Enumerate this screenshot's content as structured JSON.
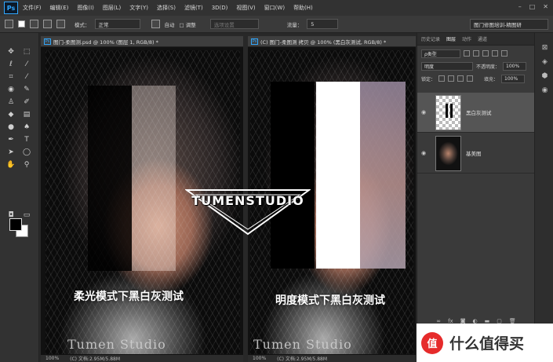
{
  "app": {
    "logo": "Ps",
    "window_buttons": [
      "–",
      "□",
      "✕"
    ]
  },
  "menu": [
    "文件(F)",
    "编辑(E)",
    "图像(I)",
    "图层(L)",
    "文字(Y)",
    "选择(S)",
    "滤镜(T)",
    "3D(D)",
    "视图(V)",
    "窗口(W)",
    "帮助(H)"
  ],
  "options": {
    "blend_label": "模式：",
    "blend_value": "正常",
    "auto_label": "自动",
    "sample_label": "□ 调整",
    "size_placeholder": "选项设置",
    "flow_label": "流量：",
    "flow_value": "5",
    "workspace": "图门修图培训-精图研"
  },
  "tools": {
    "icons": [
      "move-icon",
      "marquee-icon",
      "lasso-icon",
      "magic-wand-icon",
      "crop-icon",
      "eyedropper-icon",
      "healing-icon",
      "brush-icon",
      "stamp-icon",
      "history-brush-icon",
      "eraser-icon",
      "gradient-icon",
      "blur-icon",
      "dodge-icon",
      "pen-icon",
      "type-icon",
      "path-select-icon",
      "shape-icon",
      "hand-icon",
      "zoom-icon"
    ]
  },
  "docs": {
    "left_tab": "图门-柔图测.psd @ 100% (图层 1, RGB/8) *",
    "right_tab": "(C) 图门-柔图测 拷贝 @ 100% (黑白灰测试, RGB/8) *",
    "left_caption": "柔光模式下黑白灰测试",
    "right_caption": "明度模式下黑白灰测试",
    "left_status_zoom": "100%",
    "left_status_doc": "(C) 文档:2.95M/5.88M",
    "right_status_zoom": "100%",
    "right_status_doc": "(C) 文档:2.95M/5.88M",
    "watermark": "Tumen Studio"
  },
  "logo": {
    "text": "TUMENSTUDIO"
  },
  "panel": {
    "tabs": [
      "历史记录",
      "图层",
      "动作",
      "通道"
    ],
    "kind_filter": "ρ类型",
    "blend_mode": "明度",
    "opacity_label": "不透明度：",
    "opacity_value": "100%",
    "lock_label": "锁定：",
    "fill_label": "填充：",
    "fill_value": "100%",
    "layers": [
      {
        "name": "黑白灰测试",
        "selected": true
      },
      {
        "name": "基美图",
        "selected": false
      }
    ],
    "bottom_icons": [
      "link-icon",
      "fx-icon",
      "mask-icon",
      "adjustment-icon",
      "group-icon",
      "new-layer-icon",
      "trash-icon"
    ]
  },
  "brand": {
    "icon": "值",
    "text": "什么值得买"
  },
  "colors": {
    "accent": "#31a8ff",
    "brand_red": "#e62b2b"
  }
}
